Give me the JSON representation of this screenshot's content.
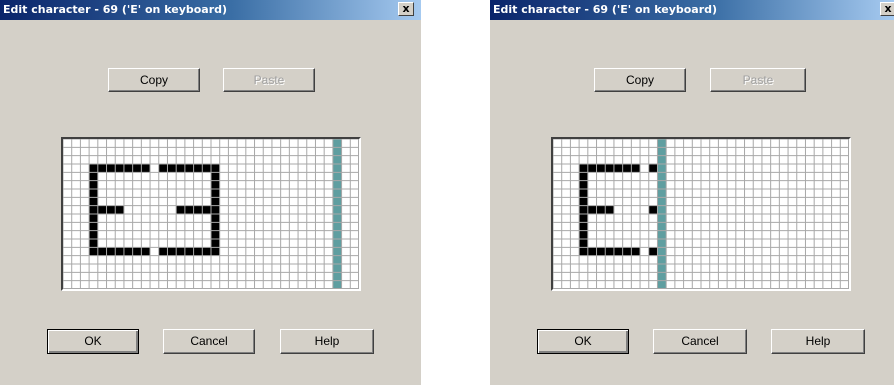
{
  "dialogs": [
    {
      "title": "Edit character -  69 ('E' on keyboard)",
      "close_glyph": "x",
      "copy_label": "Copy",
      "paste_label": "Paste",
      "ok_label": "OK",
      "cancel_label": "Cancel",
      "help_label": "Help",
      "grid": {
        "cols": 34,
        "rows": 18,
        "cursor_col": 31,
        "cursor_color": "#5f9ea0",
        "filled": [
          [
            3,
            3
          ],
          [
            4,
            3
          ],
          [
            5,
            3
          ],
          [
            6,
            3
          ],
          [
            7,
            3
          ],
          [
            8,
            3
          ],
          [
            9,
            3
          ],
          [
            3,
            4
          ],
          [
            3,
            5
          ],
          [
            3,
            6
          ],
          [
            3,
            7
          ],
          [
            3,
            8
          ],
          [
            4,
            8
          ],
          [
            5,
            8
          ],
          [
            6,
            8
          ],
          [
            3,
            9
          ],
          [
            3,
            10
          ],
          [
            3,
            11
          ],
          [
            3,
            12
          ],
          [
            3,
            13
          ],
          [
            4,
            13
          ],
          [
            5,
            13
          ],
          [
            6,
            13
          ],
          [
            7,
            13
          ],
          [
            8,
            13
          ],
          [
            9,
            13
          ],
          [
            11,
            3
          ],
          [
            12,
            3
          ],
          [
            13,
            3
          ],
          [
            14,
            3
          ],
          [
            15,
            3
          ],
          [
            16,
            3
          ],
          [
            17,
            3
          ],
          [
            17,
            4
          ],
          [
            17,
            5
          ],
          [
            17,
            6
          ],
          [
            17,
            7
          ],
          [
            13,
            8
          ],
          [
            14,
            8
          ],
          [
            15,
            8
          ],
          [
            16,
            8
          ],
          [
            17,
            8
          ],
          [
            17,
            9
          ],
          [
            17,
            10
          ],
          [
            17,
            11
          ],
          [
            17,
            12
          ],
          [
            11,
            13
          ],
          [
            12,
            13
          ],
          [
            13,
            13
          ],
          [
            14,
            13
          ],
          [
            15,
            13
          ],
          [
            16,
            13
          ],
          [
            17,
            13
          ]
        ]
      }
    },
    {
      "title": "Edit character -  69 ('E' on keyboard)",
      "close_glyph": "x",
      "copy_label": "Copy",
      "paste_label": "Paste",
      "ok_label": "OK",
      "cancel_label": "Cancel",
      "help_label": "Help",
      "grid": {
        "cols": 34,
        "rows": 18,
        "cursor_col": 12,
        "cursor_color": "#5f9ea0",
        "filled": [
          [
            3,
            3
          ],
          [
            4,
            3
          ],
          [
            5,
            3
          ],
          [
            6,
            3
          ],
          [
            7,
            3
          ],
          [
            8,
            3
          ],
          [
            9,
            3
          ],
          [
            3,
            4
          ],
          [
            3,
            5
          ],
          [
            3,
            6
          ],
          [
            3,
            7
          ],
          [
            3,
            8
          ],
          [
            4,
            8
          ],
          [
            5,
            8
          ],
          [
            6,
            8
          ],
          [
            3,
            9
          ],
          [
            3,
            10
          ],
          [
            3,
            11
          ],
          [
            3,
            12
          ],
          [
            3,
            13
          ],
          [
            4,
            13
          ],
          [
            5,
            13
          ],
          [
            6,
            13
          ],
          [
            7,
            13
          ],
          [
            8,
            13
          ],
          [
            9,
            13
          ],
          [
            11,
            3
          ],
          [
            11,
            8
          ],
          [
            11,
            13
          ]
        ]
      }
    }
  ]
}
